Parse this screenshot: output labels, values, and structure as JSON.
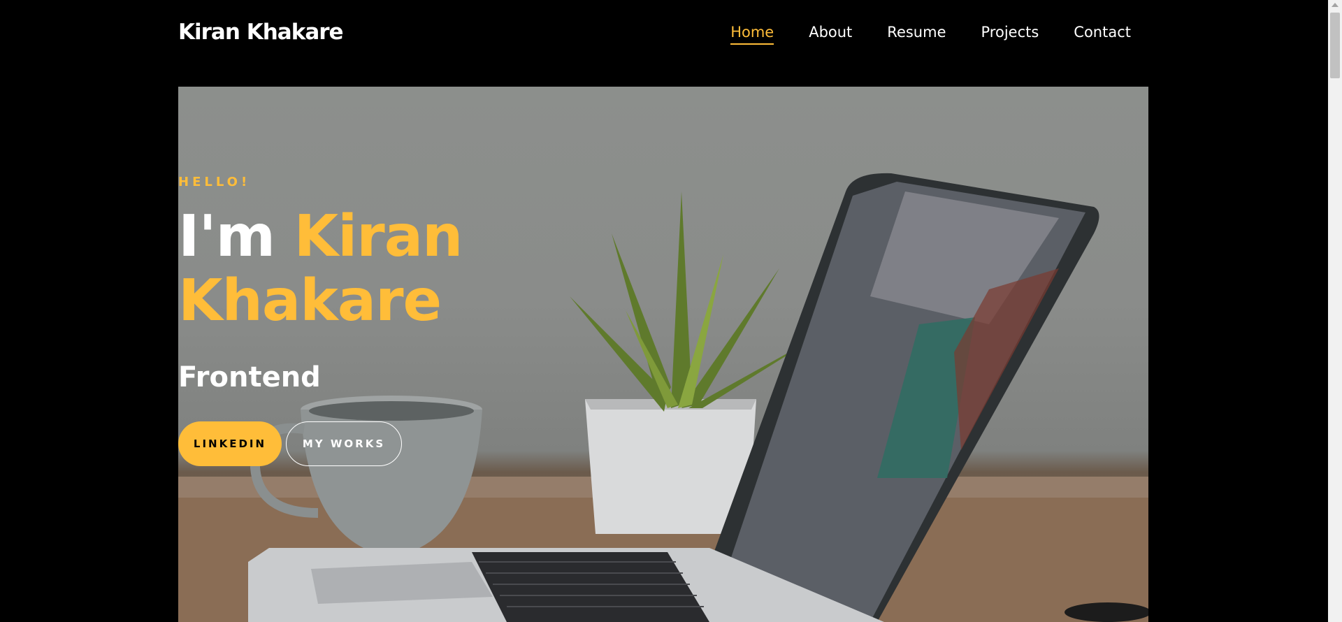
{
  "brand": "Kiran Khakare",
  "nav": {
    "items": [
      {
        "label": "Home",
        "active": true
      },
      {
        "label": "About",
        "active": false
      },
      {
        "label": "Resume",
        "active": false
      },
      {
        "label": "Projects",
        "active": false
      },
      {
        "label": "Contact",
        "active": false
      }
    ]
  },
  "hero": {
    "subheading": "HELLO!",
    "headline_prefix": "I'm",
    "headline_first": "Kiran",
    "headline_last": "Khakare",
    "role": "Frontend",
    "buttons": {
      "primary": "LINKEDIN",
      "secondary": "MY WORKS"
    }
  },
  "colors": {
    "accent": "#ffbd39",
    "background": "#000000",
    "text": "#ffffff"
  }
}
